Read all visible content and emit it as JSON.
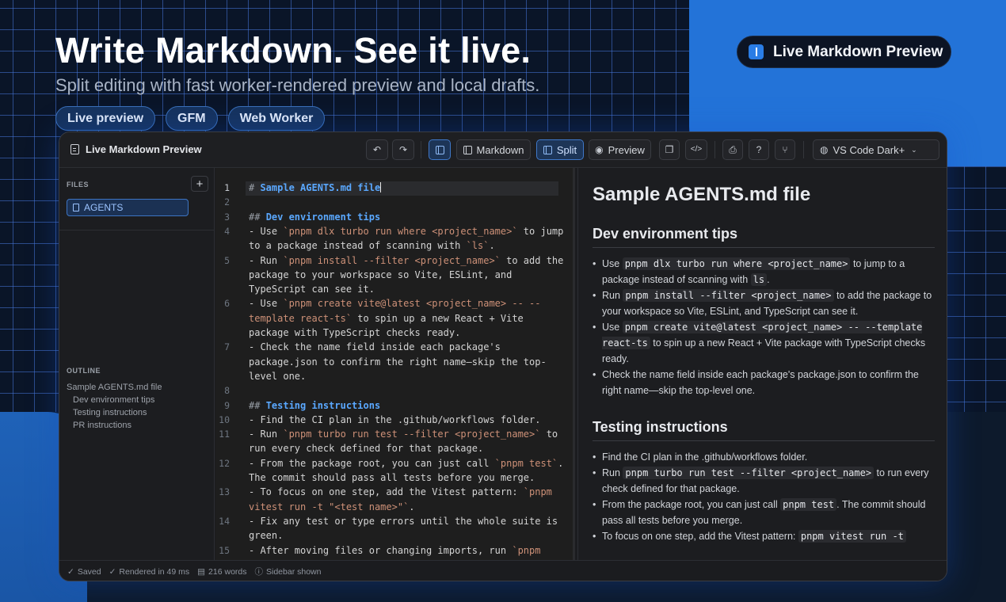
{
  "hero": {
    "title": "Write Markdown. See it live.",
    "subtitle": "Split editing with fast worker-rendered preview and local drafts.",
    "chips": [
      "Live preview",
      "GFM",
      "Web Worker"
    ],
    "badge": "Live Markdown Preview"
  },
  "app": {
    "title": "Live Markdown Preview",
    "toolbar": {
      "undo_icon": "undo-icon",
      "redo_icon": "redo-icon",
      "sidebar_toggle_icon": "sidebar-toggle-icon",
      "markdown_label": "Markdown",
      "split_label": "Split",
      "preview_label": "Preview",
      "copy_icon": "copy-icon",
      "code_icon": "code-icon",
      "print_icon": "print-icon",
      "help_icon": "help-icon",
      "source_icon": "git-fork-icon",
      "theme": "VS Code Dark+"
    },
    "active_view": "Split",
    "accent": "#3f78c9"
  },
  "sidebar": {
    "files_label": "FILES",
    "add_label": "+",
    "files": [
      "AGENTS"
    ],
    "outline_label": "OUTLINE",
    "outline": [
      "Sample AGENTS.md file",
      "Dev environment tips",
      "Testing instructions",
      "PR instructions"
    ]
  },
  "editor": {
    "line_numbers": [
      "1",
      "2",
      "3",
      "4",
      "5",
      "6",
      "7",
      "8",
      "9",
      "10",
      "11",
      "12",
      "13",
      "14",
      "15"
    ],
    "rows": [
      {
        "ln": "1",
        "segs": [
          [
            "hm",
            "# "
          ],
          [
            "h",
            "Sample AGENTS.md file"
          ]
        ]
      },
      {
        "ln": "2",
        "segs": []
      },
      {
        "ln": "3",
        "segs": [
          [
            "hm",
            "## "
          ],
          [
            "h",
            "Dev environment tips"
          ]
        ]
      },
      {
        "ln": "4",
        "segs": [
          [
            "t",
            "- Use "
          ],
          [
            "ck",
            "`pnpm dlx turbo run where <project_name>`"
          ],
          [
            "t",
            " to jump"
          ]
        ]
      },
      {
        "ln": "",
        "segs": [
          [
            "t",
            "to a package instead of scanning with "
          ],
          [
            "ck",
            "`ls`"
          ],
          [
            "t",
            "."
          ]
        ]
      },
      {
        "ln": "5",
        "segs": [
          [
            "t",
            "- Run "
          ],
          [
            "ck",
            "`pnpm install --filter <project_name>`"
          ],
          [
            "t",
            " to add the"
          ]
        ]
      },
      {
        "ln": "",
        "segs": [
          [
            "t",
            "package to your workspace so Vite, ESLint, and"
          ]
        ]
      },
      {
        "ln": "",
        "segs": [
          [
            "t",
            "TypeScript can see it."
          ]
        ]
      },
      {
        "ln": "6",
        "segs": [
          [
            "t",
            "- Use "
          ],
          [
            "ck",
            "`pnpm create vite@latest <project_name> -- --"
          ]
        ]
      },
      {
        "ln": "",
        "segs": [
          [
            "ck",
            "template react-ts`"
          ],
          [
            "t",
            " to spin up a new React + Vite"
          ]
        ]
      },
      {
        "ln": "",
        "segs": [
          [
            "t",
            "package with TypeScript checks ready."
          ]
        ]
      },
      {
        "ln": "7",
        "segs": [
          [
            "t",
            "- Check the name field inside each package's"
          ]
        ]
      },
      {
        "ln": "",
        "segs": [
          [
            "t",
            "package.json to confirm the right name—skip the top-"
          ]
        ]
      },
      {
        "ln": "",
        "segs": [
          [
            "t",
            "level one."
          ]
        ]
      },
      {
        "ln": "8",
        "segs": []
      },
      {
        "ln": "9",
        "segs": [
          [
            "hm",
            "## "
          ],
          [
            "h",
            "Testing instructions"
          ]
        ]
      },
      {
        "ln": "10",
        "segs": [
          [
            "t",
            "- Find the CI plan in the .github/workflows folder."
          ]
        ]
      },
      {
        "ln": "11",
        "segs": [
          [
            "t",
            "- Run "
          ],
          [
            "ck",
            "`pnpm turbo run test --filter <project_name>`"
          ],
          [
            "t",
            " to"
          ]
        ]
      },
      {
        "ln": "",
        "segs": [
          [
            "t",
            "run every check defined for that package."
          ]
        ]
      },
      {
        "ln": "12",
        "segs": [
          [
            "t",
            "- From the package root, you can just call "
          ],
          [
            "ck",
            "`pnpm test`"
          ],
          [
            "t",
            "."
          ]
        ]
      },
      {
        "ln": "",
        "segs": [
          [
            "t",
            "The commit should pass all tests before you merge."
          ]
        ]
      },
      {
        "ln": "13",
        "segs": [
          [
            "t",
            "- To focus on one step, add the Vitest pattern: "
          ],
          [
            "ck",
            "`pnpm"
          ]
        ]
      },
      {
        "ln": "",
        "segs": [
          [
            "ck",
            "vitest run -t \"<test name>\"`"
          ],
          [
            "t",
            "."
          ]
        ]
      },
      {
        "ln": "14",
        "segs": [
          [
            "t",
            "- Fix any test or type errors until the whole suite is"
          ]
        ]
      },
      {
        "ln": "",
        "segs": [
          [
            "t",
            "green."
          ]
        ]
      },
      {
        "ln": "15",
        "segs": [
          [
            "t",
            "- After moving files or changing imports, run "
          ],
          [
            "ck",
            "`pnpm"
          ]
        ]
      }
    ]
  },
  "preview": {
    "h1": "Sample AGENTS.md file",
    "sections": [
      {
        "h2": "Dev environment tips",
        "items": [
          [
            [
              "t",
              "Use "
            ],
            [
              "c",
              "pnpm dlx turbo run where <project_name>"
            ],
            [
              "t",
              " to jump to a package instead of scanning with "
            ],
            [
              "c",
              "ls"
            ],
            [
              "t",
              "."
            ]
          ],
          [
            [
              "t",
              "Run "
            ],
            [
              "c",
              "pnpm install --filter <project_name>"
            ],
            [
              "t",
              " to add the package to your workspace so Vite, ESLint, and TypeScript can see it."
            ]
          ],
          [
            [
              "t",
              "Use "
            ],
            [
              "c",
              "pnpm create vite@latest <project_name> -- --template react-ts"
            ],
            [
              "t",
              " to spin up a new React + Vite package with TypeScript checks ready."
            ]
          ],
          [
            [
              "t",
              "Check the name field inside each package's package.json to confirm the right name—skip the top-level one."
            ]
          ]
        ]
      },
      {
        "h2": "Testing instructions",
        "items": [
          [
            [
              "t",
              "Find the CI plan in the .github/workflows folder."
            ]
          ],
          [
            [
              "t",
              "Run "
            ],
            [
              "c",
              "pnpm turbo run test --filter <project_name>"
            ],
            [
              "t",
              " to run every check defined for that package."
            ]
          ],
          [
            [
              "t",
              "From the package root, you can just call "
            ],
            [
              "c",
              "pnpm test"
            ],
            [
              "t",
              ". The commit should pass all tests before you merge."
            ]
          ],
          [
            [
              "t",
              "To focus on one step, add the Vitest pattern: "
            ],
            [
              "c",
              "pnpm vitest run -t"
            ]
          ]
        ]
      }
    ]
  },
  "status": {
    "saved": "Saved",
    "rendered": "Rendered in 49 ms",
    "words": "216 words",
    "sidebar": "Sidebar shown"
  }
}
